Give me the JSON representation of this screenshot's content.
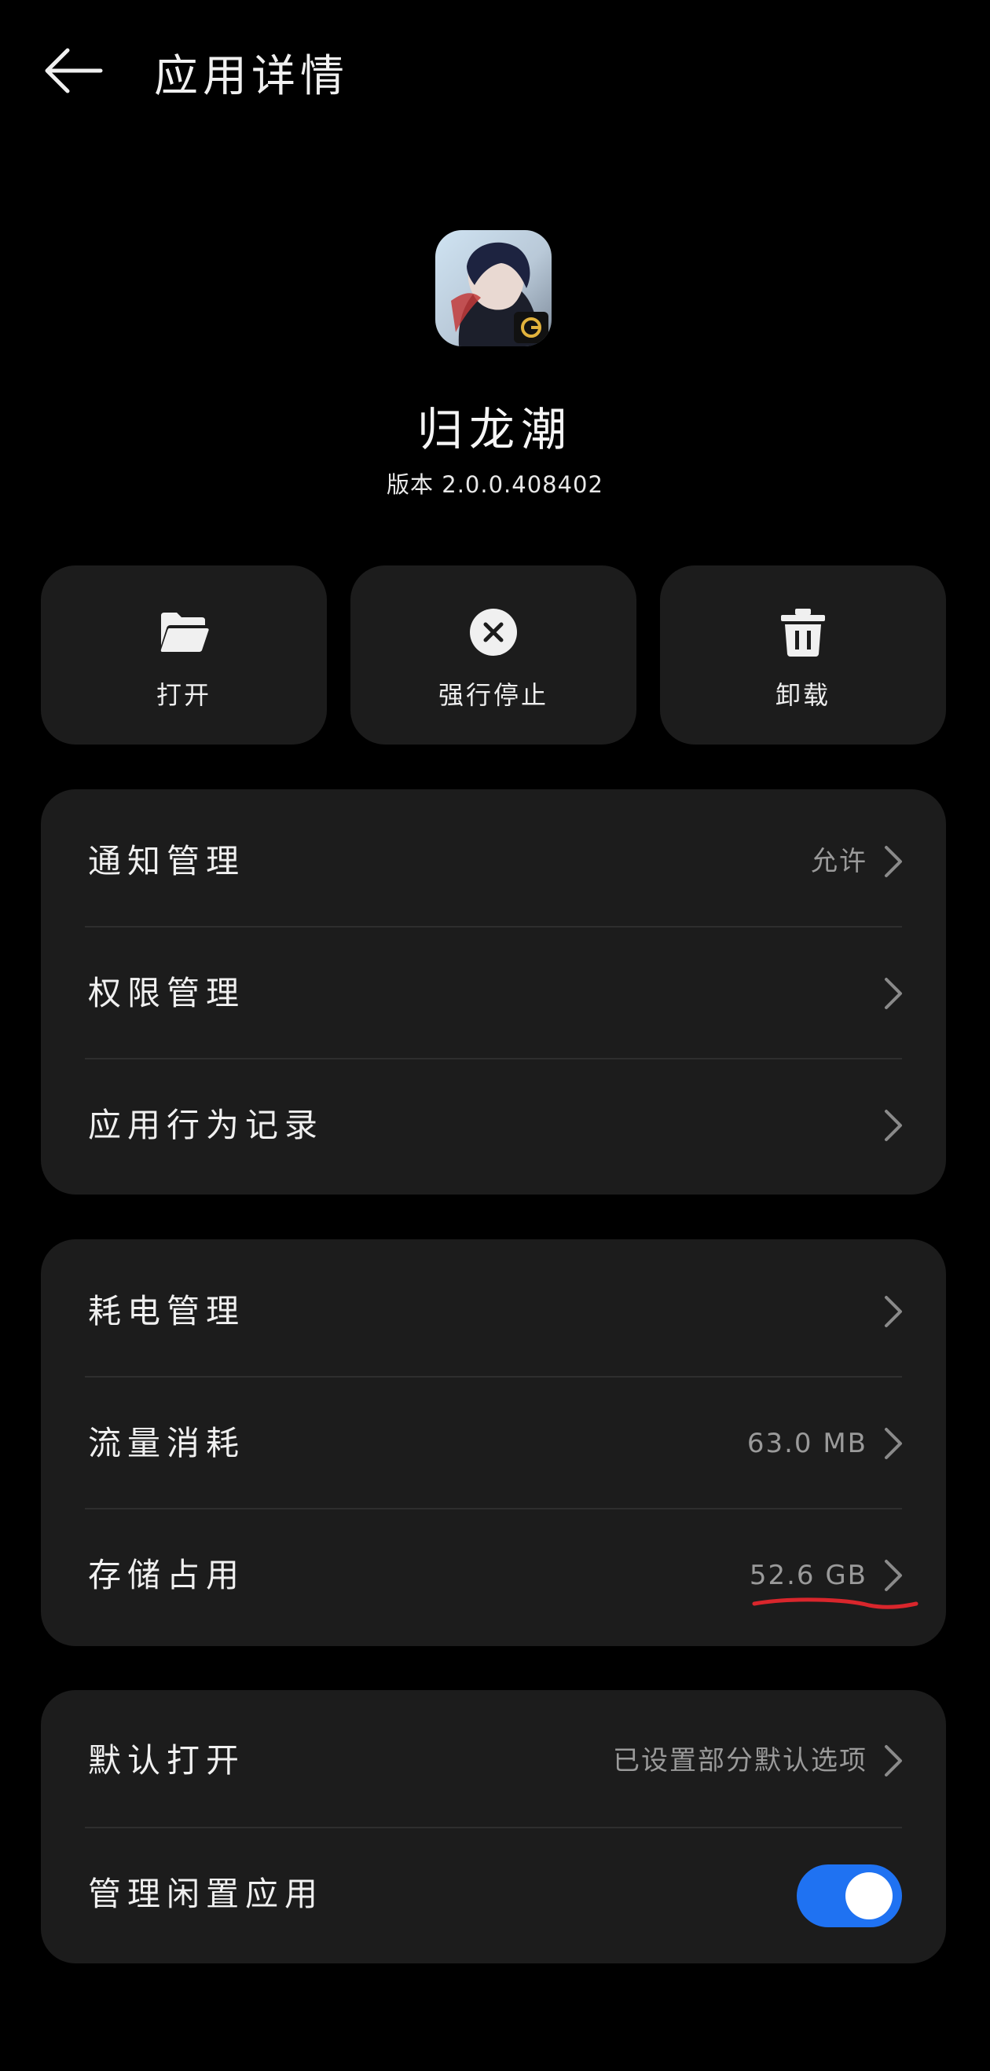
{
  "header": {
    "title": "应用详情",
    "back_icon": "arrow-left-icon"
  },
  "app": {
    "name": "归龙潮",
    "version": "版本 2.0.0.408402"
  },
  "actions": [
    {
      "label": "打开",
      "icon": "folder-open-icon"
    },
    {
      "label": "强行停止",
      "icon": "close-circle-icon"
    },
    {
      "label": "卸载",
      "icon": "trash-icon"
    }
  ],
  "group1": [
    {
      "label": "通知管理",
      "value": "允许"
    },
    {
      "label": "权限管理",
      "value": ""
    },
    {
      "label": "应用行为记录",
      "value": ""
    }
  ],
  "group2": [
    {
      "label": "耗电管理",
      "value": ""
    },
    {
      "label": "流量消耗",
      "value": "63.0 MB"
    },
    {
      "label": "存储占用",
      "value": "52.6 GB"
    }
  ],
  "group3": [
    {
      "label": "默认打开",
      "value": "已设置部分默认选项"
    },
    {
      "label": "管理闲置应用",
      "toggle_on": true
    }
  ],
  "colors": {
    "background": "#000000",
    "card": "#1c1c1c",
    "toggle_on": "#1f72f2",
    "annotation": "#d9262c"
  }
}
